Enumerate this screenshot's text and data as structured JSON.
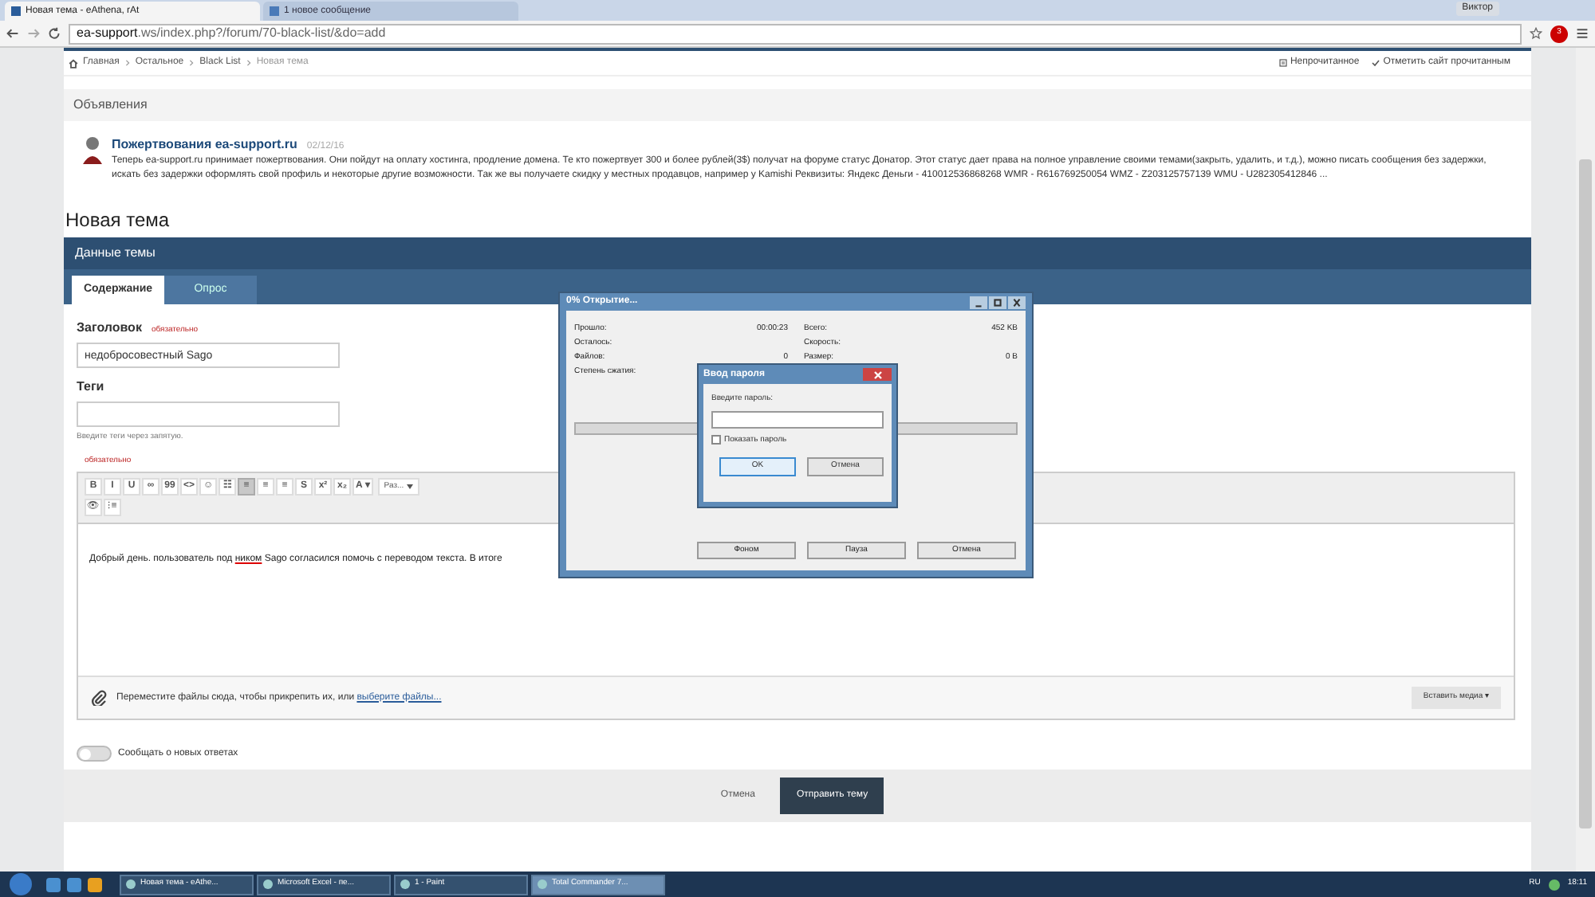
{
  "browser": {
    "tabs": [
      {
        "title": "Новая тема - eAthena, rAt",
        "selected": true
      },
      {
        "title": "1 новое сообщение",
        "selected": false
      }
    ],
    "user": "Виктор",
    "url_host": "ea-support",
    "url_rest": ".ws/index.php?/forum/70-black-list/&do=add",
    "adblock_count": "3"
  },
  "breadcrumb": {
    "items": [
      "Главная",
      "Остальное",
      "Black List",
      "Новая тема"
    ],
    "actions": [
      "Непрочитанное",
      "Отметить сайт прочитанным"
    ]
  },
  "notices": {
    "title": "Объявления",
    "items": [
      {
        "title": "Пожертвования ea-support.ru",
        "date": "02/12/16",
        "text": "Теперь ea-support.ru принимает пожертвования. Они пойдут на оплату хостинга, продление домена. Те кто пожертвует 300 и более рублей(3$) получат на форуме статус Донатор. Этот статус дает права на полное управление своими темами(закрыть, удалить, и т.д.), можно писать сообщения без задержки, искать без задержки оформлять свой профиль и некоторые другие возможности. Так же вы получаете скидку у местных продавцов, например у Kamishi Реквизиты: Яндекс Деньги - 410012536868268 WMR - R616769250054 WMZ - Z203125757139 WMU - U282305412846 ..."
      }
    ]
  },
  "heading": "Новая тема",
  "panel": {
    "title": "Данные темы",
    "tabs": [
      {
        "label": "Содержание",
        "selected": true
      },
      {
        "label": "Опрос",
        "selected": false
      }
    ]
  },
  "form": {
    "title_label": "Заголовок",
    "title_required": "обязательно",
    "title_value": "недобросовестный Sago",
    "tags_label": "Теги",
    "tags_hint": "Введите теги через запятую.",
    "editor_required": "обязательно",
    "toolbar": [
      {
        "glyph": "B",
        "selected": false
      },
      {
        "glyph": "I",
        "selected": false
      },
      {
        "glyph": "U",
        "selected": false
      },
      {
        "glyph": "∞",
        "selected": false
      },
      {
        "glyph": "99",
        "selected": false
      },
      {
        "glyph": "<>",
        "selected": false
      },
      {
        "glyph": "☺",
        "selected": false
      },
      {
        "glyph": "☷",
        "selected": false
      },
      {
        "glyph": "≡",
        "selected": true
      },
      {
        "glyph": "≡",
        "selected": false
      },
      {
        "glyph": "≡",
        "selected": false
      },
      {
        "glyph": "S",
        "selected": false
      },
      {
        "glyph": "x²",
        "selected": false
      },
      {
        "glyph": "x₂",
        "selected": false
      },
      {
        "glyph": "A ▾",
        "selected": false
      }
    ],
    "font_size": "Раз...",
    "toolbar_row2": [
      "👁",
      "⁝≡"
    ],
    "body_before": "Добрый день. пользователь под ",
    "body_misspelled": "ником",
    "body_after": " Sago согласился помочь с переводом текста. В итоге",
    "attach_text": "Переместите файлы сюда, чтобы прикрепить их, или",
    "attach_link": "выберите файлы...",
    "insert_media": "Вставить медиа ▾",
    "follow": {
      "label": "Сообщать о новых ответах",
      "on": false
    },
    "cancel": "Отмена",
    "submit": "Отправить тему"
  },
  "progress_dialog": {
    "title": "0% Открытие...",
    "left": [
      {
        "label": "Прошло:",
        "value": "00:00:23"
      },
      {
        "label": "Осталось:"
      },
      {
        "label": "Файлов:",
        "value": "0"
      },
      {
        "label": "Степень сжатия:"
      }
    ],
    "right": [
      {
        "label": "Всего:",
        "value": "452 KB"
      },
      {
        "label": "Скорость:"
      },
      {
        "label": "Размер:",
        "value": "0 B"
      }
    ],
    "level": 0,
    "buttons": [
      "Фоном",
      "Пауза",
      "Отмена"
    ]
  },
  "password_dialog": {
    "title": "Ввод пароля",
    "prompt": "Введите пароль:",
    "show_password": {
      "label": "Показать пароль",
      "checked": false
    },
    "buttons": [
      "OK",
      "Отмена"
    ]
  },
  "taskbar": {
    "tasks": [
      {
        "label": "Новая тема - eAthe...",
        "selected": false
      },
      {
        "label": "Microsoft Excel - пе...",
        "selected": false
      },
      {
        "label": "1 - Paint",
        "selected": false
      },
      {
        "label": "Total Commander 7...",
        "selected": true
      }
    ],
    "lang": "RU",
    "time": "18:11"
  }
}
